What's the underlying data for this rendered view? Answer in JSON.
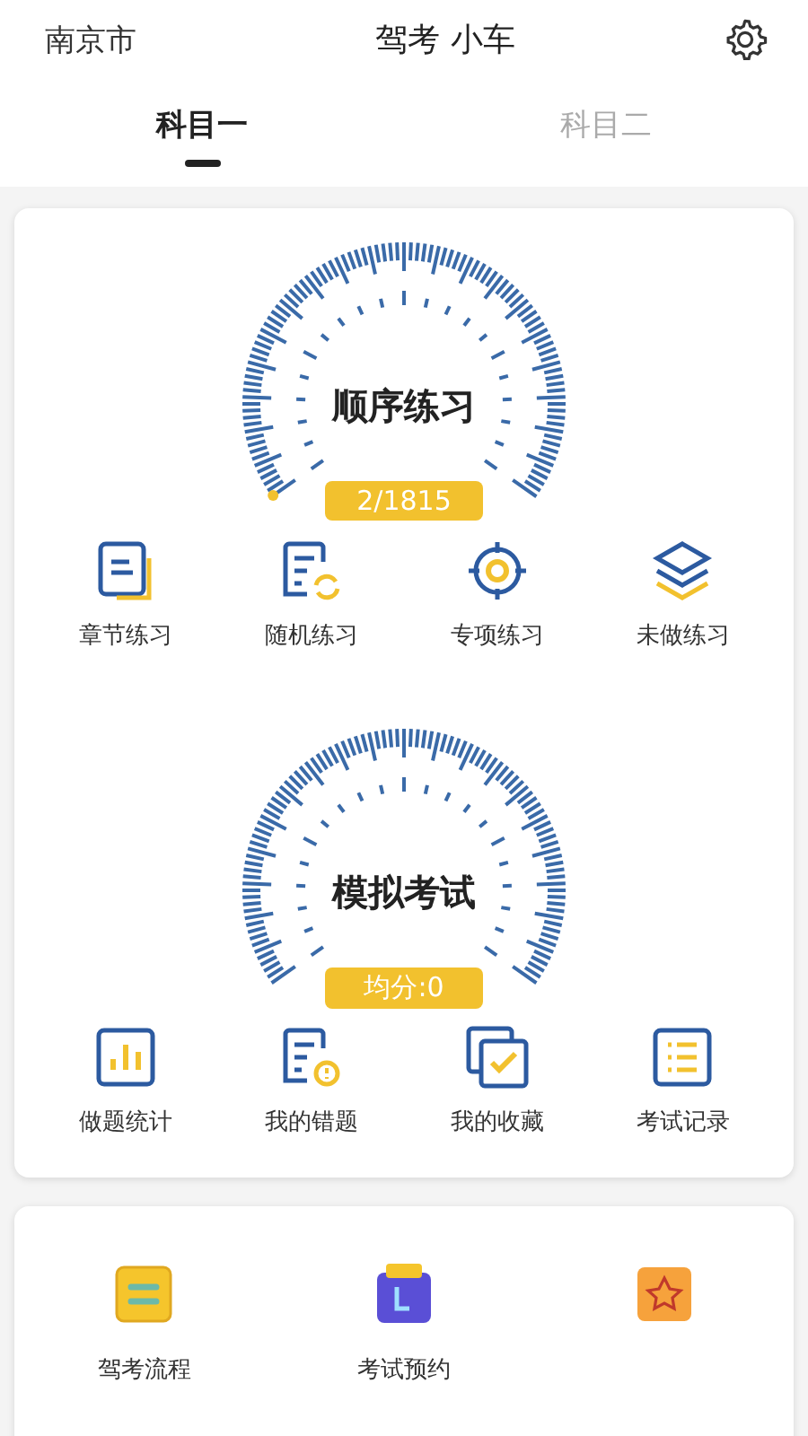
{
  "header": {
    "city": "南京市",
    "title": "驾考 小车"
  },
  "tabs": [
    {
      "label": "科目一",
      "selected": true
    },
    {
      "label": "科目二",
      "selected": false
    }
  ],
  "practice": {
    "gauge": {
      "title": "顺序练习",
      "badge": "2/1815",
      "progress_marker": true
    },
    "items": [
      {
        "label": "章节练习",
        "kind": "doc"
      },
      {
        "label": "随机练习",
        "kind": "random"
      },
      {
        "label": "专项练习",
        "kind": "target"
      },
      {
        "label": "未做练习",
        "kind": "layers"
      }
    ]
  },
  "exam": {
    "gauge": {
      "title": "模拟考试",
      "badge": "均分:0",
      "progress_marker": false
    },
    "items": [
      {
        "label": "做题统计",
        "kind": "chart"
      },
      {
        "label": "我的错题",
        "kind": "wrong"
      },
      {
        "label": "我的收藏",
        "kind": "collect"
      },
      {
        "label": "考试记录",
        "kind": "list"
      }
    ]
  },
  "guide": {
    "items": [
      {
        "label": "驾考流程",
        "kind": "flow"
      },
      {
        "label": "考试预约",
        "kind": "calendar"
      },
      {
        "kind": "star"
      }
    ]
  }
}
